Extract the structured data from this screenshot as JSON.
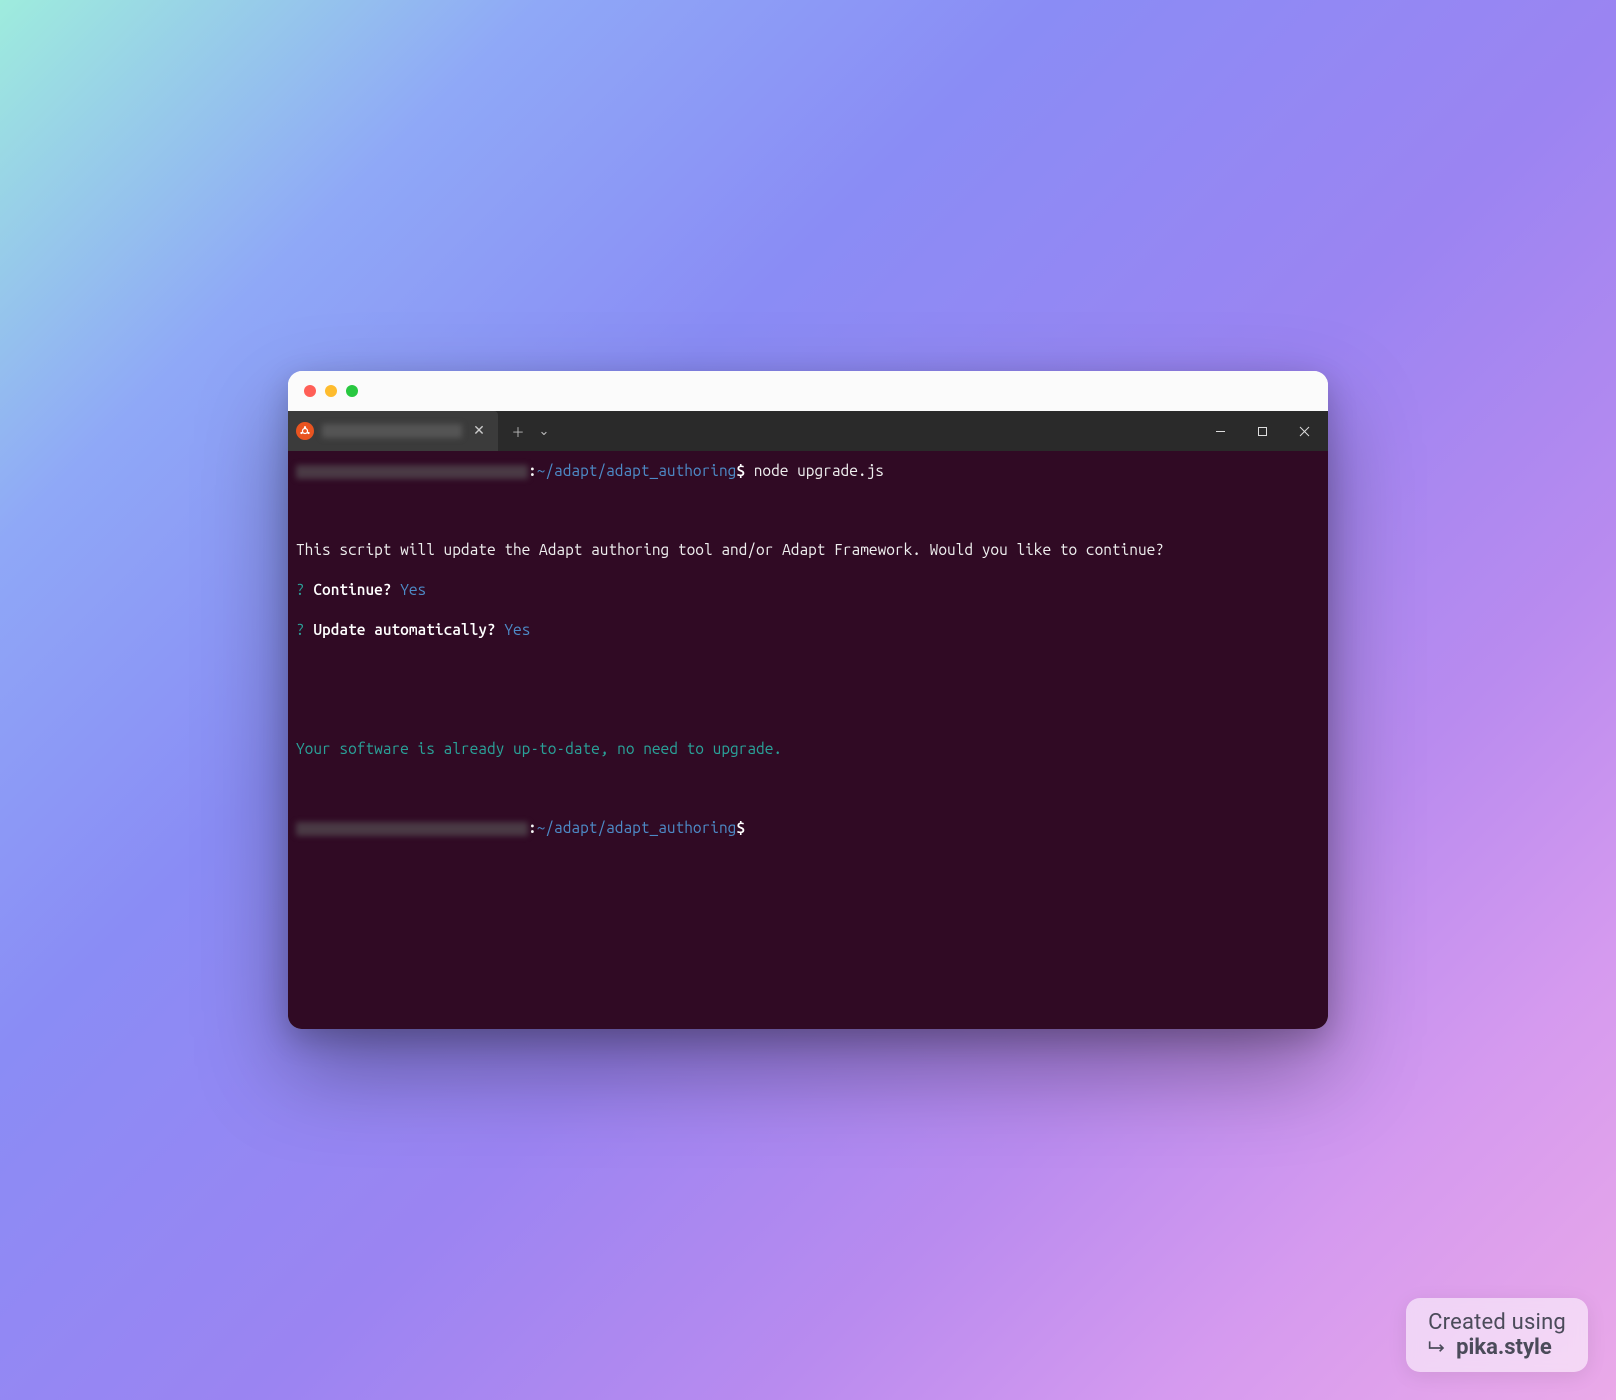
{
  "terminal": {
    "prompt1": {
      "path": "~/adapt/adapt_authoring",
      "dollar": "$",
      "sep": ":",
      "command": "node upgrade.js"
    },
    "lines": {
      "intro": "This script will update the Adapt authoring tool and/or Adapt Framework. Would you like to continue?",
      "q1_mark": "?",
      "q1_text": "Continue?",
      "q1_ans": "Yes",
      "q2_mark": "?",
      "q2_text": "Update automatically?",
      "q2_ans": "Yes",
      "status": "Your software is already up-to-date, no need to upgrade."
    },
    "prompt2": {
      "path": "~/adapt/adapt_authoring",
      "dollar": "$",
      "sep": ":"
    }
  },
  "watermark": {
    "line1": "Created using",
    "line2": "pika.style"
  }
}
